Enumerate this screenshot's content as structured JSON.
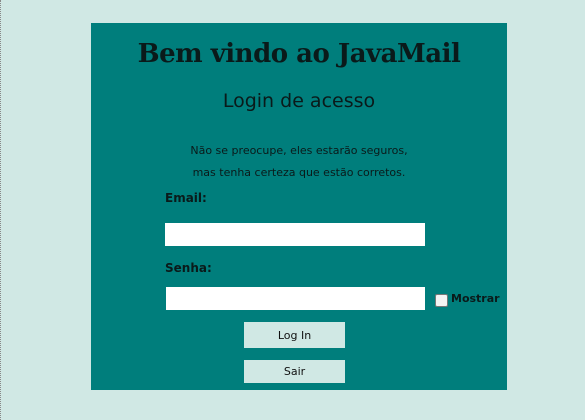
{
  "header": {
    "title": "Bem vindo ao JavaMail",
    "subtitle": "Login de acesso"
  },
  "note": {
    "line1": "Não se preocupe, eles estarão seguros,",
    "line2": "mas tenha certeza que estão corretos."
  },
  "form": {
    "email_label": "Email:",
    "email_value": "",
    "password_label": "Senha:",
    "password_value": "",
    "show_label": "Mostrar",
    "show_checked": false,
    "login_label": "Log In",
    "exit_label": "Sair"
  },
  "colors": {
    "panel": "#007e7c",
    "background": "#d0e8e4"
  }
}
